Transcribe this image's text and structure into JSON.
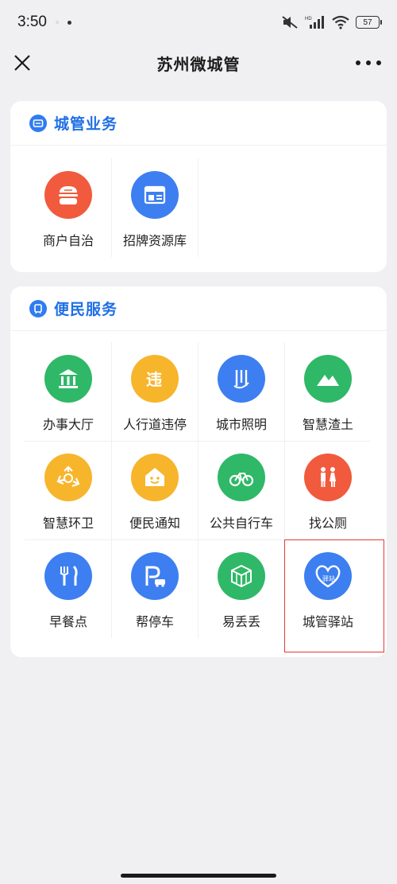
{
  "status_bar": {
    "time": "3:50",
    "battery_level": "57",
    "glyphs": [
      "mute-icon",
      "hd-signal-icon",
      "wifi-icon"
    ]
  },
  "nav": {
    "title": "苏州微城管",
    "close_icon": "close-icon",
    "more_icon": "more-icon"
  },
  "sections": {
    "business": {
      "title": "城管业务",
      "items": [
        {
          "label": "商户自治",
          "icon": "merchant-icon",
          "color": "#f15a3d"
        },
        {
          "label": "招牌资源库",
          "icon": "signboard-icon",
          "color": "#3d7ff0"
        }
      ]
    },
    "service": {
      "title": "便民服务",
      "items": [
        {
          "label": "办事大厅",
          "icon": "hall-icon",
          "color": "#2fb867"
        },
        {
          "label": "人行道违停",
          "icon": "illegal-parking-icon",
          "color": "#f7b52c"
        },
        {
          "label": "城市照明",
          "icon": "lighting-icon",
          "color": "#3d7ff0"
        },
        {
          "label": "智慧渣土",
          "icon": "mountain-icon",
          "color": "#2fb867"
        },
        {
          "label": "智慧环卫",
          "icon": "recycle-icon",
          "color": "#f7b52c"
        },
        {
          "label": "便民通知",
          "icon": "notice-house-icon",
          "color": "#f7b52c"
        },
        {
          "label": "公共自行车",
          "icon": "bicycle-icon",
          "color": "#2fb867"
        },
        {
          "label": "找公厕",
          "icon": "toilet-icon",
          "color": "#f15a3d"
        },
        {
          "label": "早餐点",
          "icon": "breakfast-icon",
          "color": "#3d7ff0"
        },
        {
          "label": "帮停车",
          "icon": "parking-icon",
          "color": "#3d7ff0"
        },
        {
          "label": "易丢丢",
          "icon": "trash-cube-icon",
          "color": "#2fb867"
        },
        {
          "label": "城管驿站",
          "icon": "heart-station-icon",
          "color": "#3d7ff0",
          "station_text": "驿站"
        }
      ]
    }
  },
  "accent_color": "#1f6fe5",
  "highlight_color": "#e53935"
}
